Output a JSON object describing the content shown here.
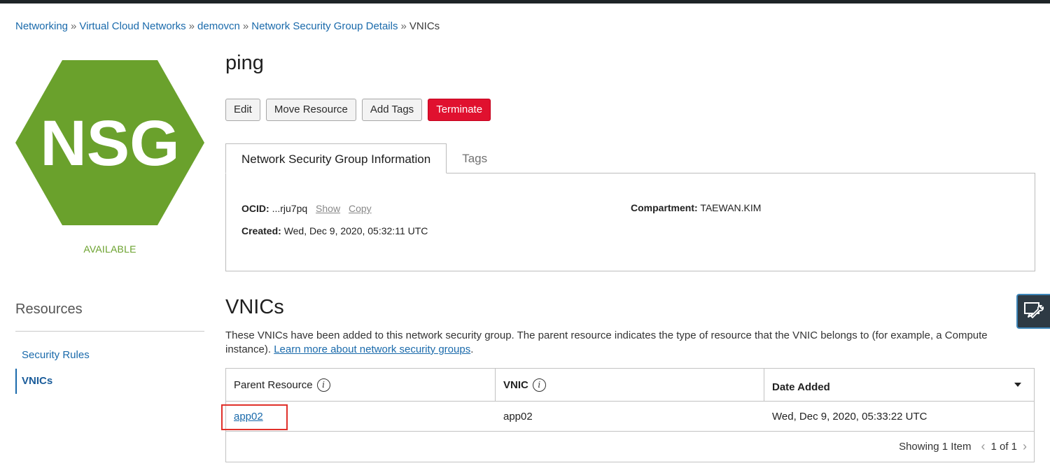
{
  "breadcrumb": {
    "items": [
      "Networking",
      "Virtual Cloud Networks",
      "demovcn",
      "Network Security Group Details"
    ],
    "current": "VNICs",
    "separator": "»"
  },
  "badge": {
    "text": "NSG",
    "status": "AVAILABLE",
    "color": "#6aa12c"
  },
  "page_title": "ping",
  "actions": {
    "edit": "Edit",
    "move": "Move Resource",
    "add_tags": "Add Tags",
    "terminate": "Terminate"
  },
  "tabs": {
    "info": "Network Security Group Information",
    "tags": "Tags"
  },
  "info": {
    "ocid_label": "OCID:",
    "ocid_value": "...rju7pq",
    "show": "Show",
    "copy": "Copy",
    "created_label": "Created:",
    "created_value": "Wed, Dec 9, 2020, 05:32:11 UTC",
    "compartment_label": "Compartment:",
    "compartment_value": "TAEWAN.KIM"
  },
  "resources": {
    "title": "Resources",
    "items": [
      "Security Rules",
      "VNICs"
    ],
    "active": "VNICs"
  },
  "section": {
    "title": "VNICs",
    "description": "These VNICs have been added to this network security group. The parent resource indicates the type of resource that the VNIC belongs to (for example, a Compute instance).",
    "learn_more": "Learn more about network security groups",
    "learn_more_suffix": "."
  },
  "table": {
    "headers": [
      "Parent Resource",
      "VNIC",
      "Date Added"
    ],
    "rows": [
      {
        "parent": "app02",
        "vnic": "app02",
        "date": "Wed, Dec 9, 2020, 05:33:22 UTC"
      }
    ],
    "footer": {
      "showing": "Showing 1 Item",
      "page": "1 of 1"
    }
  },
  "colors": {
    "accent": "#1a6aab",
    "danger": "#e0112f",
    "highlight": "#e0302a"
  }
}
